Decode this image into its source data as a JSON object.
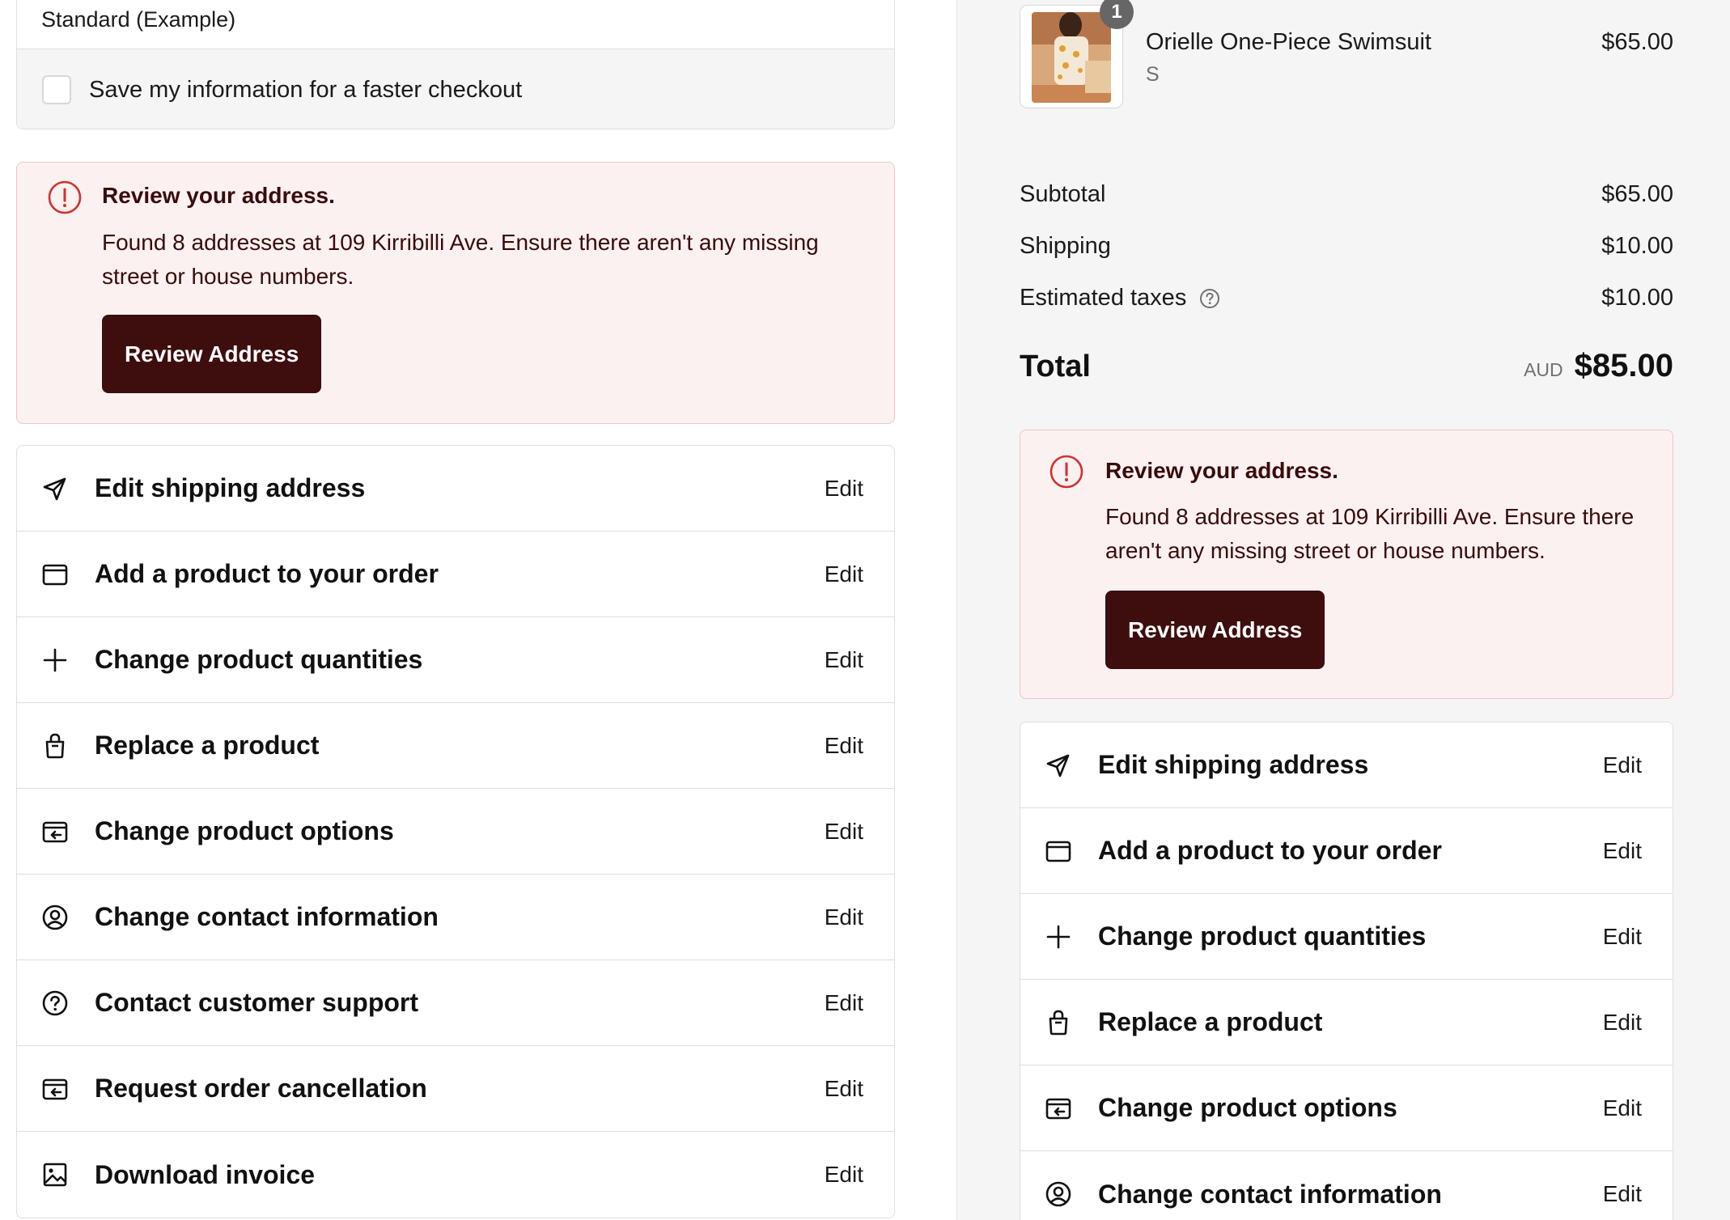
{
  "shipping": {
    "method_label": "Standard (Example)",
    "save_info_label": "Save my information for a faster checkout"
  },
  "alert": {
    "title": "Review your address.",
    "body": "Found 8 addresses at 109 Kirribilli Ave. Ensure there aren't any missing street or house numbers.",
    "button": "Review Address",
    "icon": "alert-circle-icon",
    "color_bg": "#fbf1f1",
    "color_button": "#3e0d0d"
  },
  "edit_actions": [
    {
      "label": "Edit shipping address",
      "action": "Edit",
      "icon": "navigation-arrow-icon"
    },
    {
      "label": "Add a product to your order",
      "action": "Edit",
      "icon": "product-box-icon"
    },
    {
      "label": "Change product quantities",
      "action": "Edit",
      "icon": "plus-icon"
    },
    {
      "label": "Replace a product",
      "action": "Edit",
      "icon": "shopping-bag-icon"
    },
    {
      "label": "Change product options",
      "action": "Edit",
      "icon": "product-options-icon"
    },
    {
      "label": "Change contact information",
      "action": "Edit",
      "icon": "user-circle-icon"
    },
    {
      "label": "Contact customer support",
      "action": "Edit",
      "icon": "help-circle-icon"
    },
    {
      "label": "Request order cancellation",
      "action": "Edit",
      "icon": "cancel-order-icon"
    },
    {
      "label": "Download invoice",
      "action": "Edit",
      "icon": "image-invoice-icon"
    }
  ],
  "summary": {
    "product": {
      "name": "Orielle One-Piece Swimsuit",
      "variant": "S",
      "price": "$65.00",
      "quantity": "1"
    },
    "subtotal_label": "Subtotal",
    "subtotal": "$65.00",
    "shipping_label": "Shipping",
    "shipping": "$10.00",
    "taxes_label": "Estimated taxes",
    "taxes": "$10.00",
    "total_label": "Total",
    "currency": "AUD",
    "total": "$85.00"
  }
}
